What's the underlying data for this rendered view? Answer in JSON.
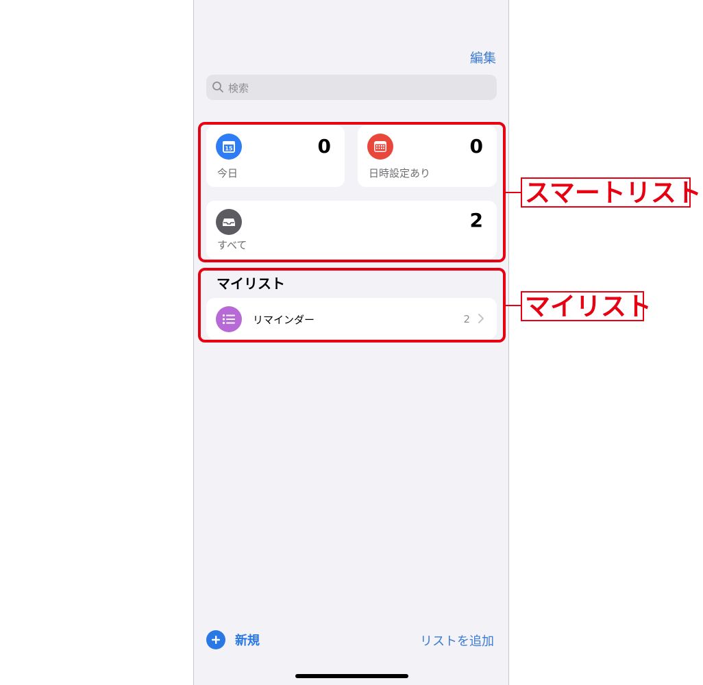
{
  "header": {
    "edit_label": "編集"
  },
  "search": {
    "placeholder": "検索"
  },
  "smart_lists": {
    "today": {
      "label": "今日",
      "count": "0",
      "icon": "calendar-icon",
      "icon_number": "15",
      "color": "#2e7cf6"
    },
    "scheduled": {
      "label": "日時設定あり",
      "count": "0",
      "icon": "calendar-grid-icon",
      "color": "#e8473c"
    },
    "all": {
      "label": "すべて",
      "count": "2",
      "icon": "inbox-icon",
      "color": "#5b5b60"
    }
  },
  "my_lists": {
    "title": "マイリスト",
    "items": [
      {
        "name": "リマインダー",
        "count": "2",
        "icon": "list-icon",
        "color": "#b76ad6"
      }
    ]
  },
  "annotations": {
    "smart_list_label": "スマートリスト",
    "my_list_label": "マイリスト"
  },
  "footer": {
    "new_label": "新規",
    "add_list_label": "リストを追加"
  }
}
